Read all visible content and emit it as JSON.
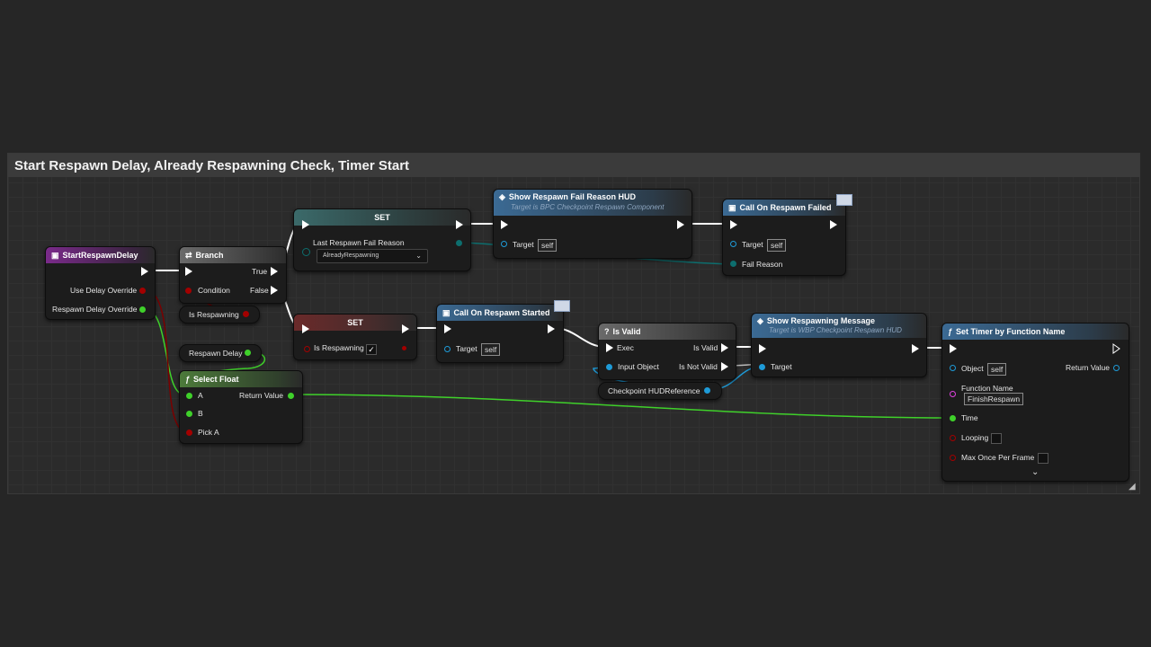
{
  "comment": {
    "title": "Start Respawn Delay, Already Respawning Check, Timer Start"
  },
  "nodes": {
    "start_respawn_delay": {
      "title": "StartRespawnDelay",
      "pins": [
        "Use Delay Override",
        "Respawn Delay Override"
      ]
    },
    "branch": {
      "title": "Branch",
      "pins": {
        "condition": "Condition",
        "true": "True",
        "false": "False"
      }
    },
    "is_respawning_var": {
      "label": "Is Respawning"
    },
    "respawn_delay_var": {
      "label": "Respawn Delay"
    },
    "select_float": {
      "title": "Select Float",
      "pins": {
        "a": "A",
        "b": "B",
        "pick_a": "Pick A",
        "return": "Return Value"
      }
    },
    "set_fail_reason": {
      "title": "SET",
      "pin": "Last Respawn Fail Reason",
      "value": "AlreadyRespawning"
    },
    "set_is_respawning": {
      "title": "SET",
      "pin": "Is Respawning"
    },
    "show_fail_hud": {
      "title": "Show Respawn Fail Reason HUD",
      "subtitle": "Target is BPC Checkpoint Respawn Component",
      "target": "Target",
      "target_value": "self"
    },
    "call_failed": {
      "title": "Call On Respawn Failed",
      "target": "Target",
      "target_value": "self",
      "fail_reason": "Fail Reason"
    },
    "call_started": {
      "title": "Call On Respawn Started",
      "target": "Target",
      "target_value": "self"
    },
    "is_valid": {
      "title": "Is Valid",
      "exec": "Exec",
      "input": "Input Object",
      "valid": "Is Valid",
      "not_valid": "Is Not Valid"
    },
    "checkpoint_hud_ref": {
      "label": "Checkpoint HUDReference"
    },
    "show_respawning_msg": {
      "title": "Show Respawning Message",
      "subtitle": "Target is WBP Checkpoint Respawn HUD",
      "target": "Target"
    },
    "set_timer": {
      "title": "Set Timer by Function Name",
      "object": "Object",
      "object_value": "self",
      "return": "Return Value",
      "function_name": "Function Name",
      "function_value": "FinishRespawn",
      "time": "Time",
      "looping": "Looping",
      "max_once": "Max Once Per Frame"
    }
  },
  "colors": {
    "exec": "#ffffff",
    "bool": "#a30000",
    "float": "#3fd12a",
    "object": "#1e9bd8",
    "enum": "#0d6e6e",
    "string": "#e040e0"
  }
}
